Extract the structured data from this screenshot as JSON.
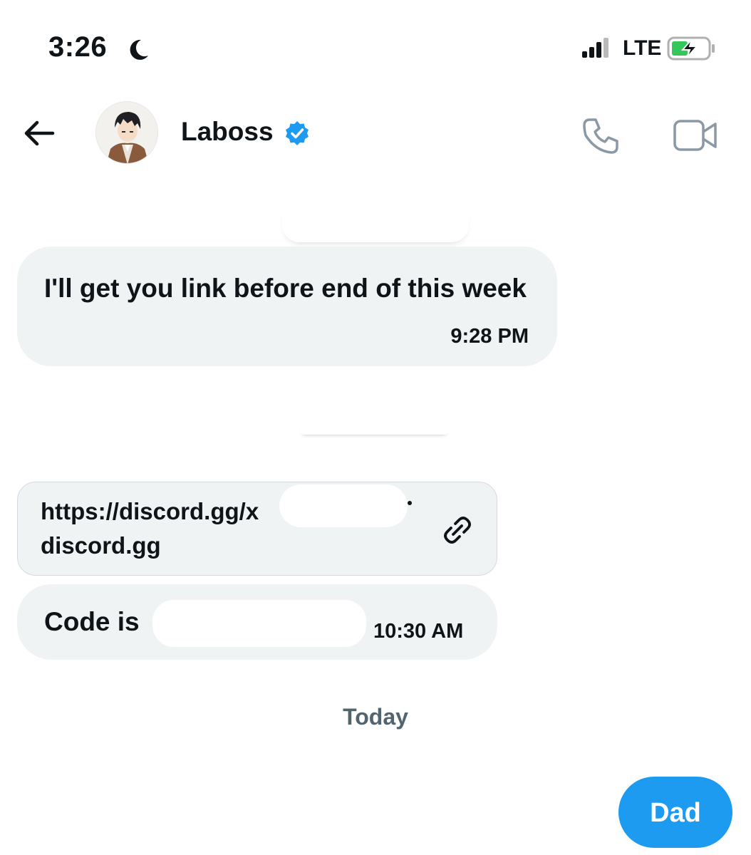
{
  "status_bar": {
    "time": "3:26",
    "network": "LTE",
    "icons": [
      "moon-icon",
      "signal-icon",
      "battery-charging-icon"
    ]
  },
  "header": {
    "contact_name": "Laboss",
    "verified": true,
    "icons": [
      "back-arrow-icon",
      "verified-badge-icon",
      "phone-icon",
      "video-camera-icon"
    ]
  },
  "messages": [
    {
      "text": "I'll get you link before end of this week",
      "time": "9:28 PM"
    },
    {
      "link_url": "https://discord.gg/x",
      "link_domain": "discord.gg",
      "icon": "link-icon"
    },
    {
      "text": "Code is",
      "time": "10:30 AM"
    }
  ],
  "day_separator": "Today",
  "sent": {
    "text": "Dad"
  },
  "colors": {
    "accent": "#1d9bf0",
    "bubble": "#eff3f4",
    "text": "#0f1419",
    "muted": "#536471",
    "battery": "#34c759"
  }
}
